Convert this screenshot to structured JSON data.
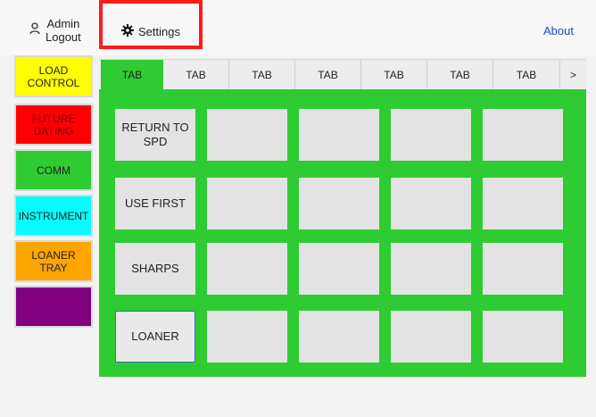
{
  "header": {
    "user_line1": "Admin",
    "user_line2": "Logout",
    "settings_label": "Settings",
    "about_label": "About",
    "highlight_color": "#ff1a1a"
  },
  "categories": [
    {
      "label": "LOAD\nCONTROL",
      "bg": "#ffff00",
      "fg": "#222222"
    },
    {
      "label": "FUTURE\nDATING",
      "bg": "#ff0000",
      "fg": "#7a0000"
    },
    {
      "label": "COMM",
      "bg": "#2ecc32",
      "fg": "#222222"
    },
    {
      "label": "INSTRUMENT",
      "bg": "#00ffff",
      "fg": "#222222"
    },
    {
      "label": "LOANER\nTRAY",
      "bg": "#ffa500",
      "fg": "#222222"
    },
    {
      "label": "",
      "bg": "#800080",
      "fg": "#222222"
    }
  ],
  "tabs": {
    "labels": [
      "TAB",
      "TAB",
      "TAB",
      "TAB",
      "TAB",
      "TAB",
      "TAB"
    ],
    "active_index": 0,
    "more_label": ">"
  },
  "buttons": {
    "rows": [
      [
        "RETURN TO\nSPD",
        "",
        "",
        "",
        ""
      ],
      [
        "USE FIRST",
        "",
        "",
        "",
        ""
      ],
      [
        "SHARPS",
        "",
        "",
        "",
        ""
      ],
      [
        "LOANER",
        "",
        "",
        "",
        ""
      ]
    ]
  },
  "colors": {
    "panel_green": "#2ecc32",
    "link_blue": "#1f3fd1",
    "button_grey": "#e3e3e3"
  }
}
